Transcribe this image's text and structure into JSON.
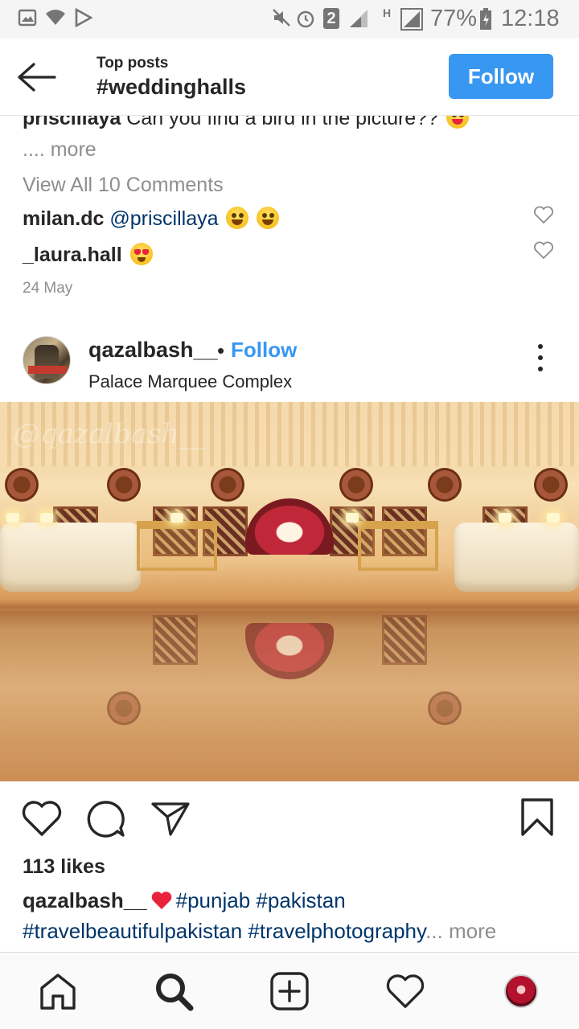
{
  "status_bar": {
    "badge": "2",
    "network": "H",
    "battery": "77%",
    "time": "12:18"
  },
  "header": {
    "subtitle": "Top posts",
    "title": "#weddinghalls",
    "follow_label": "Follow"
  },
  "previous_post": {
    "caption_user": "priscillaya",
    "caption_text": "Can you find a bird in the picture??",
    "more_label": ".... more",
    "view_all_comments": "View All 10 Comments",
    "comments": [
      {
        "user": "milan.dc",
        "mention": "@priscillaya",
        "emoji": "grinning-sweat-emoji"
      },
      {
        "user": "_laura.hall",
        "emoji": "heart-eyes-emoji"
      }
    ],
    "date": "24 May"
  },
  "post": {
    "username": "qazalbash__",
    "follow_label": "Follow",
    "location": "Palace Marquee Complex",
    "watermark": "@qazalbash__",
    "likes": "113 likes",
    "caption_user": "qazalbash__",
    "caption_tags_line1": "#punjab #pakistan",
    "caption_tags_line2": "#travelbeautifulpakistan #travelphotography",
    "caption_more": "... more"
  },
  "icons": {
    "back": "arrow-left-icon",
    "options": "more-vertical-icon",
    "like": "heart-outline-icon",
    "comment": "comment-bubble-icon",
    "share": "paper-plane-icon",
    "save": "bookmark-icon"
  },
  "nav": {
    "items": [
      "home",
      "search",
      "add-post",
      "activity",
      "profile"
    ]
  },
  "colors": {
    "accent": "#3897f0",
    "link": "#003569",
    "muted": "#8e8e8e"
  }
}
